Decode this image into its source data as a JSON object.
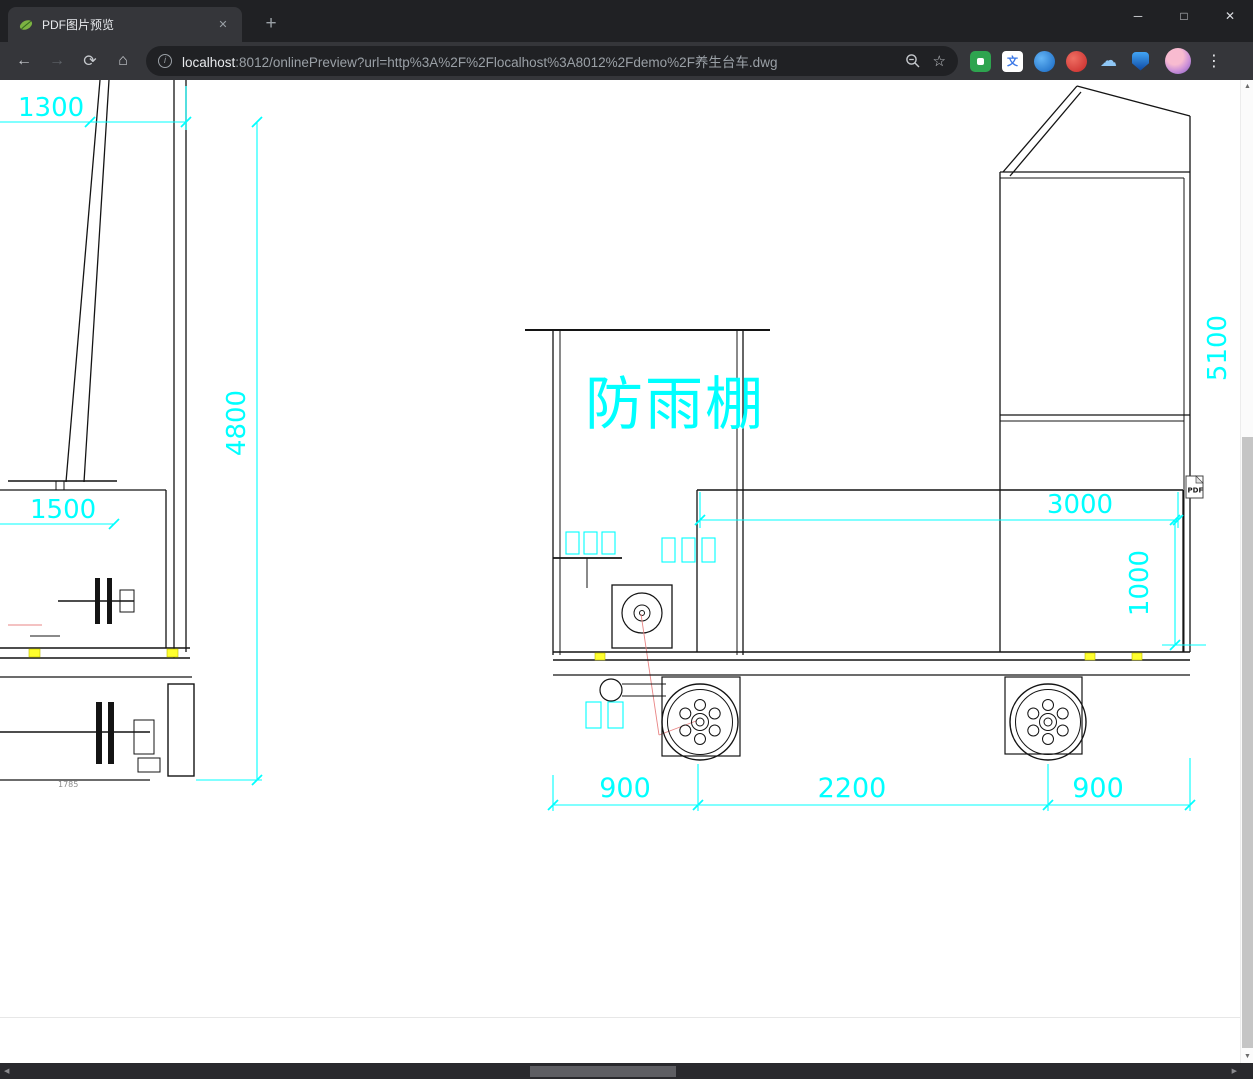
{
  "browser": {
    "tab": {
      "title": "PDF图片预览",
      "close_glyph": "✕"
    },
    "new_tab_glyph": "+",
    "window_controls": {
      "minimize": "─",
      "maximize": "□",
      "close": "✕"
    },
    "nav": {
      "back": "←",
      "forward": "→",
      "reload": "⟳",
      "home": "⌂"
    },
    "omnibox": {
      "info_glyph": "i",
      "url_host": "localhost",
      "url_rest": ":8012/onlinePreview?url=http%3A%2F%2Flocalhost%3A8012%2Fdemo%2F养生台车.dwg",
      "star_glyph": "☆"
    },
    "extensions": {
      "translate_glyph": "文",
      "cloud_glyph": "☁",
      "items": [
        "green-extension",
        "translate-extension",
        "blue-circle-extension",
        "red-extension",
        "cloud-extension",
        "shield-extension"
      ]
    },
    "menu_glyph": "⋮"
  },
  "viewer": {
    "pdf_badge": "PDF",
    "scrollbar": {
      "up": "▲",
      "down": "▼",
      "left": "◀",
      "right": "▶"
    }
  },
  "drawing": {
    "colors": {
      "dimension": "#00ffff",
      "line": "#141414",
      "highlight": "#ffff2e",
      "leader": "#e98585"
    },
    "labels": {
      "left_top_width": "1300",
      "left_height": "4800",
      "left_width": "1500",
      "left_small": "1785",
      "shelter": "防雨棚",
      "right_height": "5100",
      "deck_length": "3000",
      "deck_height": "1000",
      "span_left": "900",
      "span_mid": "2200",
      "span_right": "900"
    }
  }
}
